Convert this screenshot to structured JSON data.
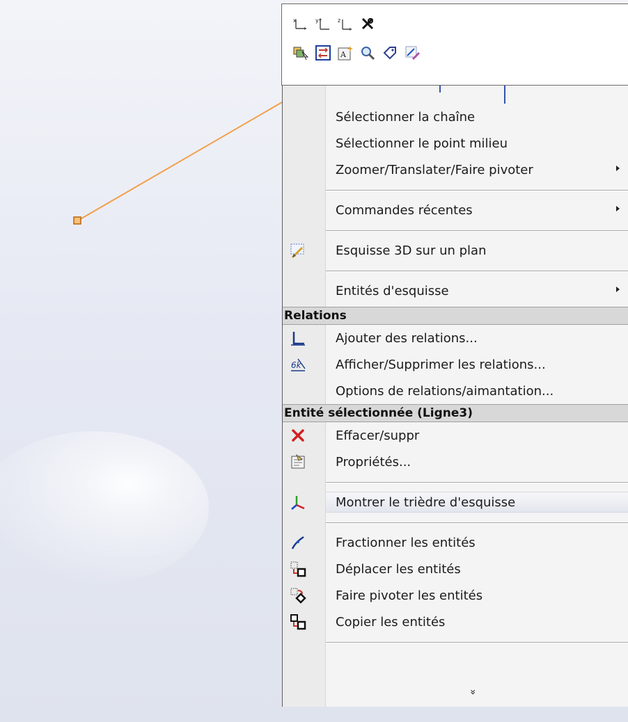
{
  "toolbar": {
    "row1": [
      {
        "name": "x-axis-icon",
        "glyph": "x"
      },
      {
        "name": "y-axis-icon",
        "glyph": "y"
      },
      {
        "name": "z-axis-icon",
        "glyph": "z"
      },
      {
        "name": "relation-tool-icon",
        "glyph": "rel"
      }
    ],
    "row2": [
      {
        "name": "select-arrow-icon"
      },
      {
        "name": "parallel-icon"
      },
      {
        "name": "text-note-icon"
      },
      {
        "name": "zoom-icon"
      },
      {
        "name": "tag-icon"
      },
      {
        "name": "sketch-edit-icon"
      }
    ]
  },
  "menu": {
    "items_a": [
      {
        "label": "Sélectionner la chaîne"
      },
      {
        "label": "Sélectionner le point milieu"
      },
      {
        "label": "Zoomer/Translater/Faire pivoter",
        "submenu": true
      }
    ],
    "recent": {
      "label": "Commandes récentes",
      "submenu": true
    },
    "sketch3d": {
      "label": "Esquisse 3D sur un plan",
      "icon": "sketch-3d-plane-icon"
    },
    "sketch_entities": {
      "label": "Entités d'esquisse",
      "submenu": true
    },
    "relations_header": "Relations",
    "relations": [
      {
        "label": "Ajouter des relations...",
        "icon": "add-relation-icon"
      },
      {
        "label": "Afficher/Supprimer les relations...",
        "icon": "display-relations-icon"
      },
      {
        "label": "Options de relations/aimantation..."
      }
    ],
    "entity_header": "Entité sélectionnée (Ligne3)",
    "entity_items": [
      {
        "label": "Effacer/suppr",
        "icon": "delete-x-icon"
      },
      {
        "label": "Propriétés...",
        "icon": "properties-icon"
      }
    ],
    "triad": {
      "label": "Montrer le trièdre d'esquisse",
      "icon": "triad-icon"
    },
    "tools": [
      {
        "label": "Fractionner les entités",
        "icon": "split-entities-icon"
      },
      {
        "label": "Déplacer les entités",
        "icon": "move-entities-icon"
      },
      {
        "label": "Faire pivoter les entités",
        "icon": "rotate-entities-icon"
      },
      {
        "label": "Copier les entités",
        "icon": "copy-entities-icon"
      }
    ],
    "more_glyph": "»"
  },
  "colors": {
    "line": "#f0a04a",
    "delete": "#d22020",
    "relation": "#1a3a8a"
  }
}
